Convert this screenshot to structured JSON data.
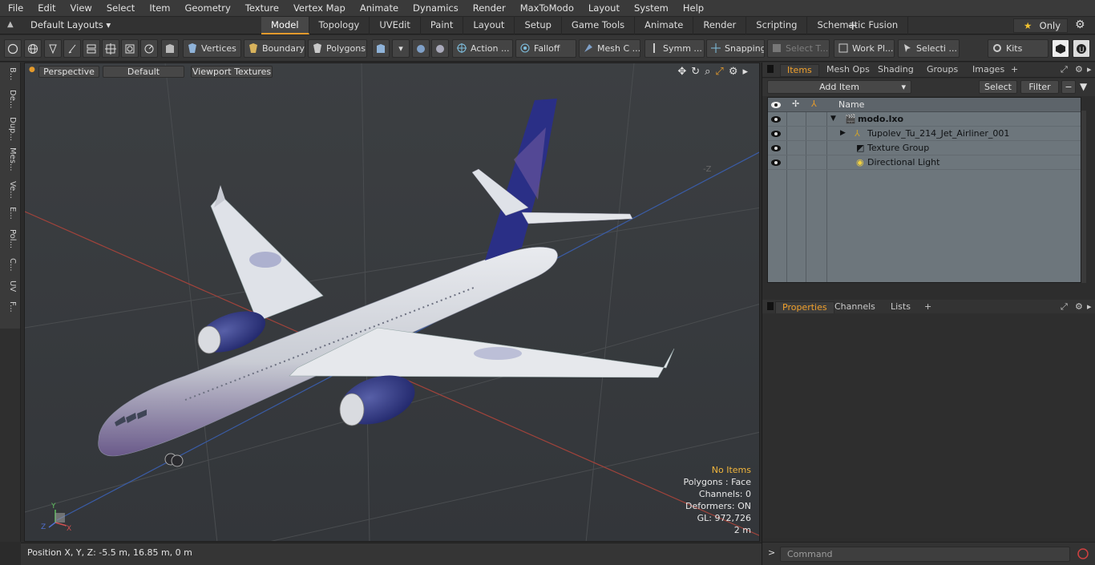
{
  "menubar": [
    "File",
    "Edit",
    "View",
    "Select",
    "Item",
    "Geometry",
    "Texture",
    "Vertex Map",
    "Animate",
    "Dynamics",
    "Render",
    "MaxToModo",
    "Layout",
    "System",
    "Help"
  ],
  "layouts": {
    "label": "Default Layouts ▾"
  },
  "tabs": [
    "Model",
    "Topology",
    "UVEdit",
    "Paint",
    "Layout",
    "Setup",
    "Game Tools",
    "Animate",
    "Render",
    "Scripting",
    "Schematic Fusion"
  ],
  "active_tab": "Model",
  "only_label": "Only",
  "toolbar": {
    "vertices": "Vertices",
    "boundary": "Boundary",
    "polygons": "Polygons",
    "action": "Action ...",
    "falloff": "Falloff",
    "meshc": "Mesh C ...",
    "symm": "Symm ...",
    "snapping": "Snapping",
    "selectt": "Select T...",
    "workpl": "Work Pl...",
    "selecti": "Selecti ...",
    "kits": "Kits"
  },
  "left_strip": [
    "B...",
    "De...",
    "Dup...",
    "Mes...",
    "Ve...",
    "E...",
    "Pol...",
    "C...",
    "UV",
    "F..."
  ],
  "viewport": {
    "view": "Perspective",
    "shading": "Default",
    "textures": "Viewport Textures",
    "info": {
      "no_items": "No Items",
      "polygons": "Polygons : Face",
      "channels": "Channels: 0",
      "deformers": "Deformers: ON",
      "gl": "GL: 972,726",
      "scale": "2 m"
    },
    "axis_label": "-Z"
  },
  "statusbar": {
    "position": "Position X, Y, Z:   -5.5 m, 16.85 m, 0 m"
  },
  "items_panel": {
    "tabs": [
      "Items",
      "Mesh Ops",
      "Shading",
      "Groups",
      "Images"
    ],
    "add_item": "Add Item",
    "select": "Select",
    "filter": "Filter",
    "header_name": "Name",
    "rows": [
      {
        "name": "modo.lxo"
      },
      {
        "name": "Tupolev_Tu_214_Jet_Airliner_001"
      },
      {
        "name": "Texture Group"
      },
      {
        "name": "Directional Light"
      }
    ]
  },
  "props_panel": {
    "tabs": [
      "Properties",
      "Channels",
      "Lists"
    ]
  },
  "command": {
    "placeholder": "Command"
  },
  "colors": {
    "accent": "#e49a2c",
    "list_bg": "#6d767c",
    "viewport_bg": "#383838"
  }
}
